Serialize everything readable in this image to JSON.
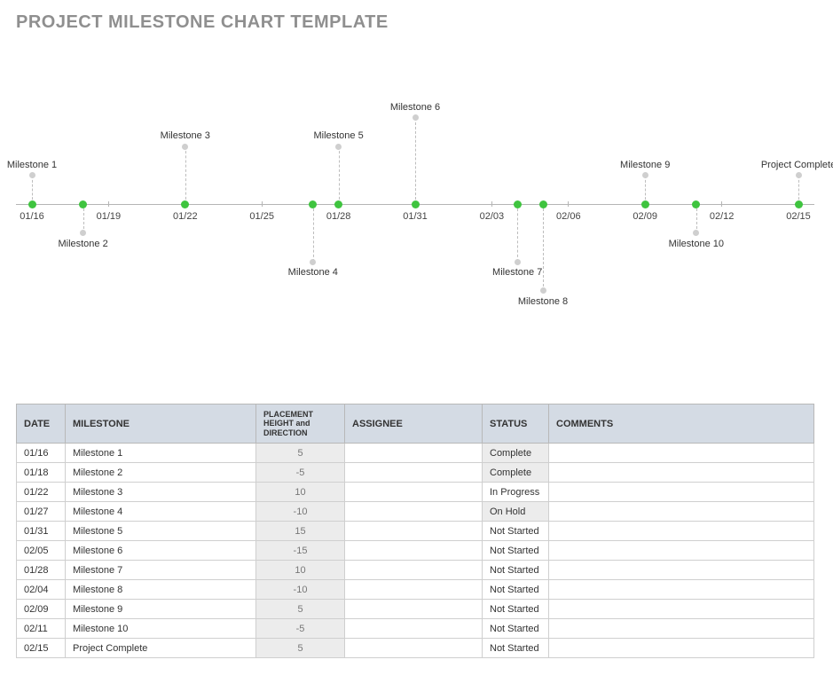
{
  "title": "PROJECT MILESTONE CHART TEMPLATE",
  "chart_data": {
    "type": "timeline",
    "x_ticks": [
      "01/16",
      "01/19",
      "01/22",
      "01/25",
      "01/28",
      "01/31",
      "02/03",
      "02/06",
      "02/09",
      "02/12",
      "02/15"
    ],
    "x_range": [
      "01/16",
      "02/15"
    ],
    "milestones": [
      {
        "date": "01/16",
        "label": "Milestone 1",
        "height": 5
      },
      {
        "date": "01/18",
        "label": "Milestone 2",
        "height": -5
      },
      {
        "date": "01/22",
        "label": "Milestone 3",
        "height": 10
      },
      {
        "date": "01/27",
        "label": "Milestone 4",
        "height": -10
      },
      {
        "date": "01/28",
        "label": "Milestone 5",
        "height": 10
      },
      {
        "date": "01/31",
        "label": "Milestone 6",
        "height": 15
      },
      {
        "date": "02/04",
        "label": "Milestone 7",
        "height": -10
      },
      {
        "date": "02/05",
        "label": "Milestone 8",
        "height": -15
      },
      {
        "date": "02/09",
        "label": "Milestone 9",
        "height": 5
      },
      {
        "date": "02/11",
        "label": "Milestone 10",
        "height": -5
      },
      {
        "date": "02/15",
        "label": "Project Complete",
        "height": 5
      }
    ]
  },
  "table": {
    "headers": {
      "date": "DATE",
      "milestone": "MILESTONE",
      "placement": "PLACEMENT HEIGHT and DIRECTION",
      "assignee": "ASSIGNEE",
      "status": "STATUS",
      "comments": "COMMENTS"
    },
    "rows": [
      {
        "date": "01/16",
        "milestone": "Milestone 1",
        "placement": "5",
        "assignee": "",
        "status": "Complete",
        "status_shaded": true,
        "comments": ""
      },
      {
        "date": "01/18",
        "milestone": "Milestone 2",
        "placement": "-5",
        "assignee": "",
        "status": "Complete",
        "status_shaded": true,
        "comments": ""
      },
      {
        "date": "01/22",
        "milestone": "Milestone 3",
        "placement": "10",
        "assignee": "",
        "status": "In Progress",
        "status_shaded": false,
        "comments": ""
      },
      {
        "date": "01/27",
        "milestone": "Milestone 4",
        "placement": "-10",
        "assignee": "",
        "status": "On Hold",
        "status_shaded": true,
        "comments": ""
      },
      {
        "date": "01/31",
        "milestone": "Milestone 5",
        "placement": "15",
        "assignee": "",
        "status": "Not Started",
        "status_shaded": false,
        "comments": ""
      },
      {
        "date": "02/05",
        "milestone": "Milestone 6",
        "placement": "-15",
        "assignee": "",
        "status": "Not Started",
        "status_shaded": false,
        "comments": ""
      },
      {
        "date": "01/28",
        "milestone": "Milestone 7",
        "placement": "10",
        "assignee": "",
        "status": "Not Started",
        "status_shaded": false,
        "comments": ""
      },
      {
        "date": "02/04",
        "milestone": "Milestone 8",
        "placement": "-10",
        "assignee": "",
        "status": "Not Started",
        "status_shaded": false,
        "comments": ""
      },
      {
        "date": "02/09",
        "milestone": "Milestone 9",
        "placement": "5",
        "assignee": "",
        "status": "Not Started",
        "status_shaded": false,
        "comments": ""
      },
      {
        "date": "02/11",
        "milestone": "Milestone 10",
        "placement": "-5",
        "assignee": "",
        "status": "Not Started",
        "status_shaded": false,
        "comments": ""
      },
      {
        "date": "02/15",
        "milestone": "Project Complete",
        "placement": "5",
        "assignee": "",
        "status": "Not Started",
        "status_shaded": false,
        "comments": ""
      }
    ]
  }
}
